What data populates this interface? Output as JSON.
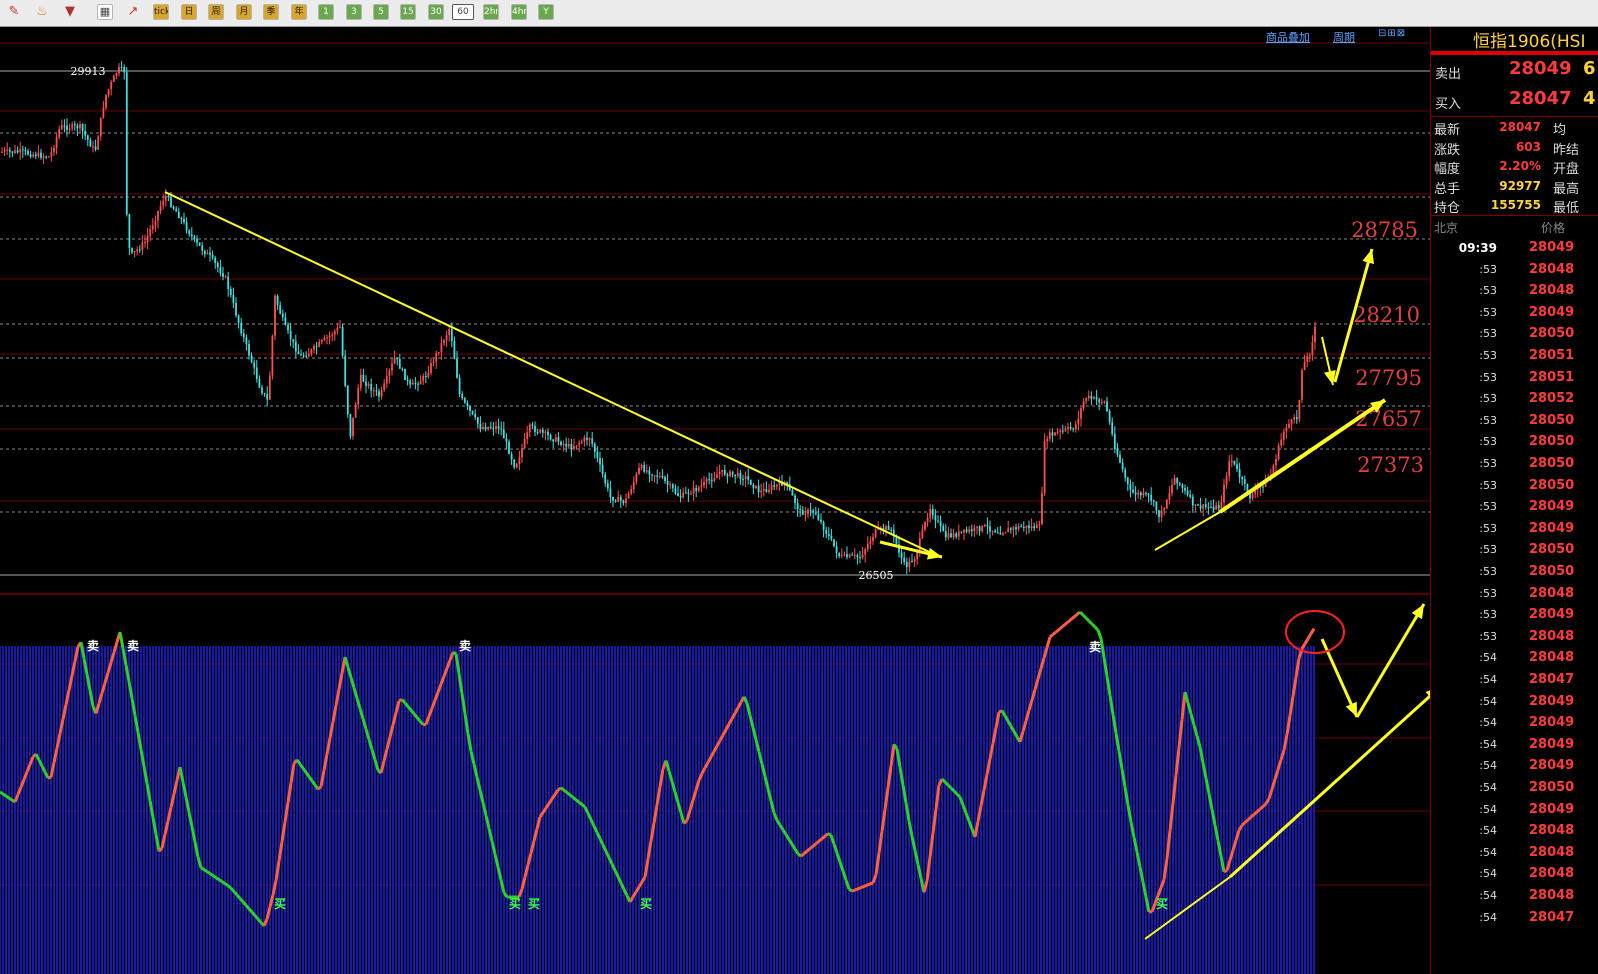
{
  "toolbar": {
    "icons": [
      "pencil-icon",
      "bell-icon",
      "filter-icon",
      "table-icon",
      "line-chart-icon"
    ],
    "buttons": [
      {
        "label": "tick",
        "kind": "period"
      },
      {
        "label": "日",
        "kind": "period"
      },
      {
        "label": "周",
        "kind": "period"
      },
      {
        "label": "月",
        "kind": "period"
      },
      {
        "label": "季",
        "kind": "period"
      },
      {
        "label": "年",
        "kind": "period"
      },
      {
        "label": "1",
        "kind": "num"
      },
      {
        "label": "3",
        "kind": "num"
      },
      {
        "label": "5",
        "kind": "num"
      },
      {
        "label": "15",
        "kind": "num"
      },
      {
        "label": "30",
        "kind": "num"
      },
      {
        "label": "60",
        "kind": "sel"
      },
      {
        "label": "2hr",
        "kind": "num"
      },
      {
        "label": "4hr",
        "kind": "num"
      },
      {
        "label": "Y",
        "kind": "num"
      }
    ]
  },
  "chart_header": {
    "overlay_link": "商品叠加",
    "period_link": "周期",
    "window_buttons": "⊟⊞⊠"
  },
  "chart_data": {
    "type": "candlestick",
    "price_high_label": "29913",
    "price_low_label": "26505",
    "level_labels": [
      "28785",
      "28210",
      "27795",
      "27657",
      "27373"
    ],
    "indicator_signals": {
      "sell_label": "卖",
      "buy_label": "买"
    }
  },
  "panel": {
    "title": "恒指1906(HSI",
    "sell": {
      "label": "卖出",
      "price": "28049",
      "vol": "6"
    },
    "buy": {
      "label": "买入",
      "price": "28047",
      "vol": "4"
    },
    "stats": [
      {
        "label": "最新",
        "value": "28047",
        "color": "#ff3b3b",
        "label2": "均"
      },
      {
        "label": "涨跌",
        "value": "603",
        "color": "#ff3b3b",
        "label2": "昨结"
      },
      {
        "label": "幅度",
        "value": "2.20%",
        "color": "#ff3b3b",
        "label2": "开盘"
      },
      {
        "label": "总手",
        "value": "92977",
        "color": "#ffd23a",
        "label2": "最高"
      },
      {
        "label": "持仓",
        "value": "155755",
        "color": "#ffd23a",
        "label2": "最低"
      }
    ],
    "ticks_header": {
      "time": "北京",
      "price": "价格"
    },
    "ticks": [
      {
        "t": "09:39",
        "p": "28049"
      },
      {
        "t": ":53",
        "p": "28048"
      },
      {
        "t": ":53",
        "p": "28048"
      },
      {
        "t": ":53",
        "p": "28049"
      },
      {
        "t": ":53",
        "p": "28050"
      },
      {
        "t": ":53",
        "p": "28051"
      },
      {
        "t": ":53",
        "p": "28051"
      },
      {
        "t": ":53",
        "p": "28052"
      },
      {
        "t": ":53",
        "p": "28050"
      },
      {
        "t": ":53",
        "p": "28050"
      },
      {
        "t": ":53",
        "p": "28050"
      },
      {
        "t": ":53",
        "p": "28050"
      },
      {
        "t": ":53",
        "p": "28049"
      },
      {
        "t": ":53",
        "p": "28049"
      },
      {
        "t": ":53",
        "p": "28050"
      },
      {
        "t": ":53",
        "p": "28050"
      },
      {
        "t": ":53",
        "p": "28048"
      },
      {
        "t": ":53",
        "p": "28049"
      },
      {
        "t": ":53",
        "p": "28048"
      },
      {
        "t": ":54",
        "p": "28048"
      },
      {
        "t": ":54",
        "p": "28047"
      },
      {
        "t": ":54",
        "p": "28049"
      },
      {
        "t": ":54",
        "p": "28049"
      },
      {
        "t": ":54",
        "p": "28049"
      },
      {
        "t": ":54",
        "p": "28049"
      },
      {
        "t": ":54",
        "p": "28050"
      },
      {
        "t": ":54",
        "p": "28049"
      },
      {
        "t": ":54",
        "p": "28048"
      },
      {
        "t": ":54",
        "p": "28048"
      },
      {
        "t": ":54",
        "p": "28048"
      },
      {
        "t": ":54",
        "p": "28048"
      },
      {
        "t": ":54",
        "p": "28047"
      }
    ]
  }
}
